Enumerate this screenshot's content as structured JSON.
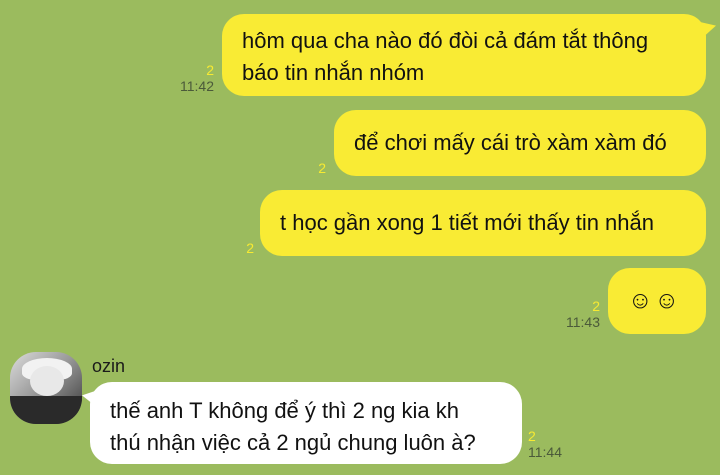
{
  "messages": [
    {
      "text_line1": "hôm qua cha nào đó đòi cả đám tắt thông",
      "text_line2": "báo tin nhắn nhóm",
      "unread": "2",
      "time": "11:42"
    },
    {
      "text": "để chơi mấy cái trò xàm xàm đó",
      "unread": "2"
    },
    {
      "text": "t học gần xong 1 tiết mới thấy tin nhắn",
      "unread": "2"
    },
    {
      "text": "☺☺",
      "unread": "2",
      "time": "11:43"
    }
  ],
  "incoming": {
    "sender": "ozin",
    "text_line1": "thế anh T không để ý thì 2 ng kia kh",
    "text_line2": "thú nhận việc cả 2 ngủ chung luôn à?",
    "unread": "2",
    "time": "11:44"
  },
  "colors": {
    "background": "#9bbb5e",
    "outgoing_bubble": "#f9eb34",
    "incoming_bubble": "#ffffff",
    "unread_count": "#f7ea32"
  }
}
